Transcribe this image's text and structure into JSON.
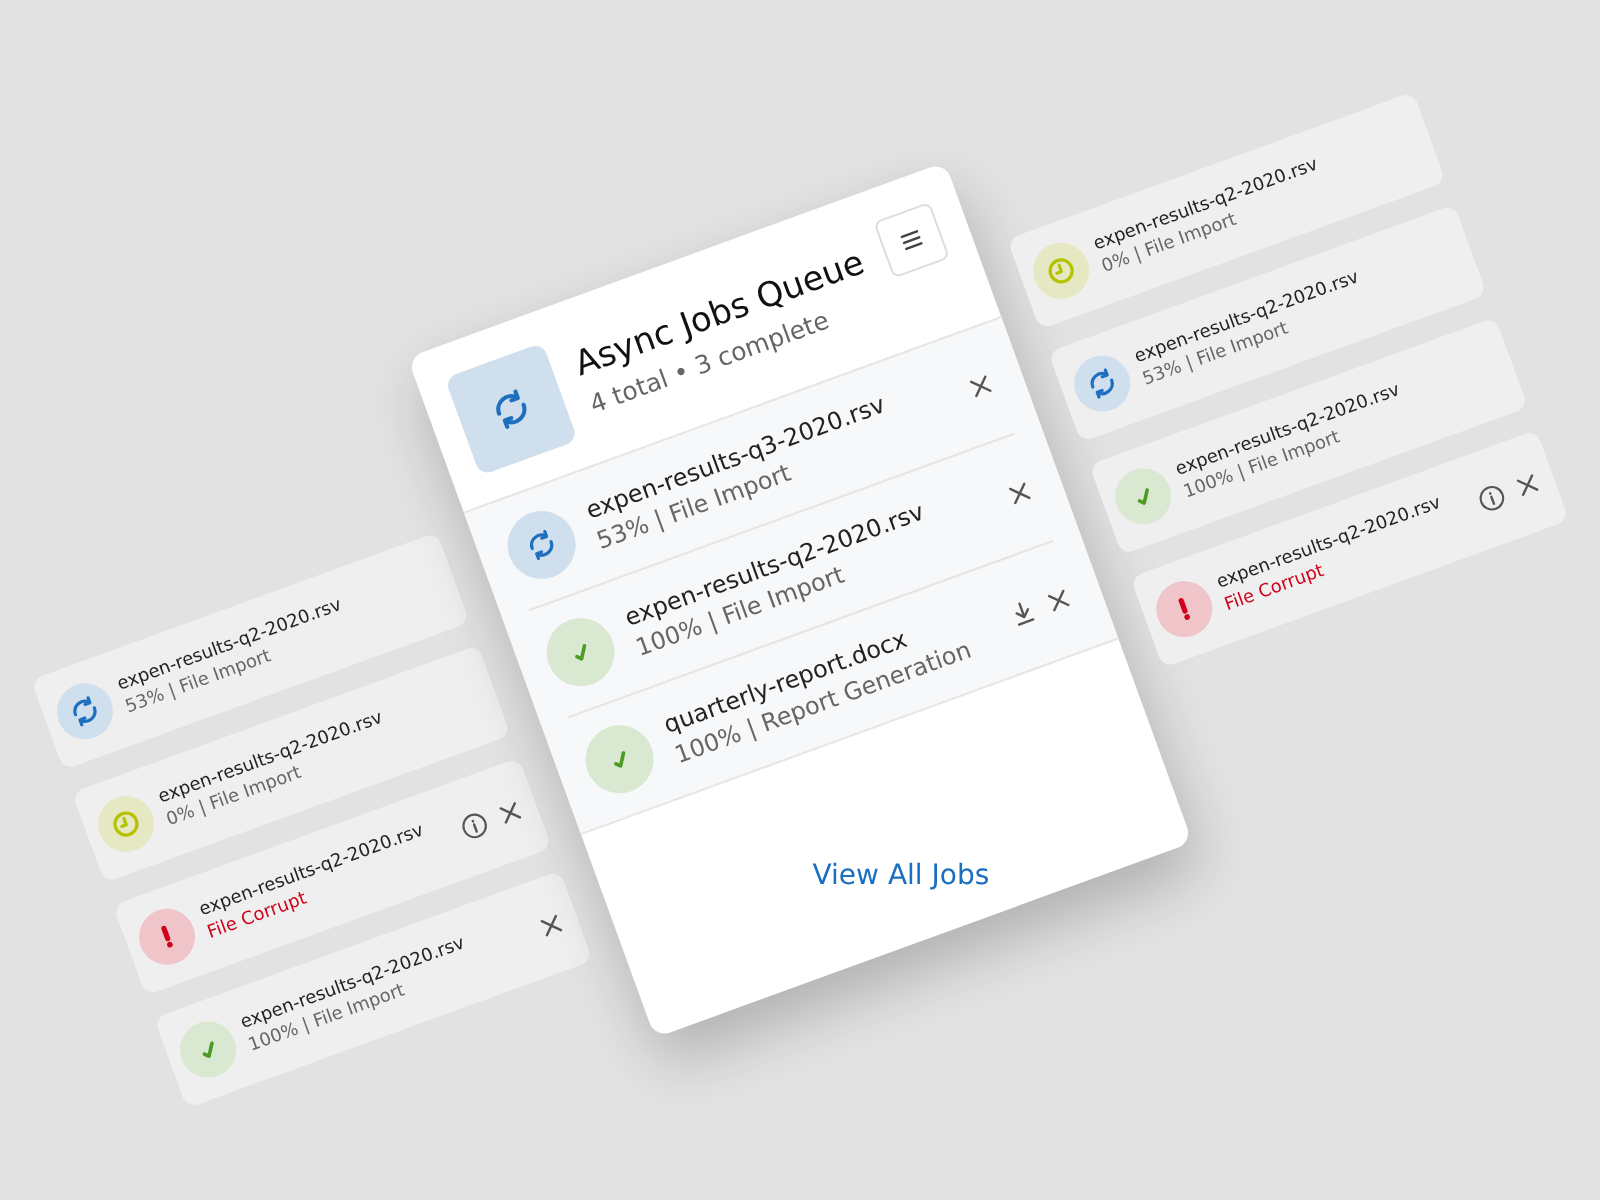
{
  "background_left": [
    {
      "kind": "running",
      "name": "expen-results-q2-2020.rsv",
      "status": "53% | File Import"
    },
    {
      "kind": "queued",
      "name": "expen-results-q2-2020.rsv",
      "status": "0% | File Import"
    },
    {
      "kind": "error",
      "name": "expen-results-q2-2020.rsv",
      "status": "File Corrupt",
      "actions": [
        {
          "kind": "info"
        },
        {
          "kind": "close"
        }
      ]
    },
    {
      "kind": "done",
      "name": "expen-results-q2-2020.rsv",
      "status": "100% | File Import",
      "actions": [
        {
          "kind": "close"
        }
      ]
    }
  ],
  "queue": {
    "title": "Async Jobs Queue",
    "summary": "4 total • 3 complete",
    "jobs": [
      {
        "kind": "running",
        "name": "expen-results-q3-2020.rsv",
        "status": "53% | File Import",
        "actions": [
          {
            "kind": "close"
          }
        ]
      },
      {
        "kind": "done",
        "name": "expen-results-q2-2020.rsv",
        "status": "100% | File Import",
        "actions": [
          {
            "kind": "close"
          }
        ]
      },
      {
        "kind": "done",
        "name": "quarterly-report.docx",
        "status": "100% | Report Generation",
        "actions": [
          {
            "kind": "download"
          },
          {
            "kind": "close"
          }
        ]
      }
    ],
    "footer_link": "View All Jobs"
  },
  "background_right": [
    {
      "kind": "queued",
      "name": "expen-results-q2-2020.rsv",
      "status": "0% | File Import"
    },
    {
      "kind": "running",
      "name": "expen-results-q2-2020.rsv",
      "status": "53% | File Import"
    },
    {
      "kind": "done",
      "name": "expen-results-q2-2020.rsv",
      "status": "100% | File Import"
    },
    {
      "kind": "error",
      "name": "expen-results-q2-2020.rsv",
      "status": "File Corrupt",
      "actions": [
        {
          "kind": "info"
        },
        {
          "kind": "close"
        }
      ]
    }
  ]
}
